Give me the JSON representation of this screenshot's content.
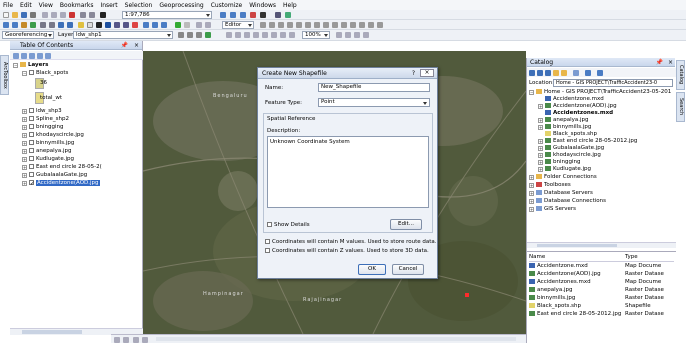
{
  "menu": [
    "File",
    "Edit",
    "View",
    "Bookmarks",
    "Insert",
    "Selection",
    "Geoprocessing",
    "Customize",
    "Windows",
    "Help"
  ],
  "toolbar": {
    "scale": "1:97,786",
    "editor": "Editor",
    "zoom": "100%",
    "georef_label": "Georeferencing",
    "layer_label": "Layer:",
    "layer_value": "ldw_shp1"
  },
  "toc": {
    "title": "Table Of Contents",
    "layers_label": "Layers",
    "items": [
      "Black_spots",
      "36",
      "total_wt",
      "ldw_shp3",
      "Spline_shp2",
      "bningging",
      "khodayscircle.jpg",
      "binnymills.jpg",
      "anepalya.jpg",
      "Kudlugate.jpg",
      "East end circle 28-05-2(",
      "GubalaalaGate.jpg",
      "Accidentzone(AOD.jpg"
    ]
  },
  "dialog": {
    "title": "Create New Shapefile",
    "help": "?",
    "name_label": "Name:",
    "name_value": "New_Shapefile",
    "type_label": "Feature Type:",
    "type_value": "Point",
    "spatial_ref": "Spatial Reference",
    "desc_label": "Description:",
    "desc_value": "Unknown Coordinate System",
    "show_details": "Show Details",
    "edit": "Edit...",
    "m_values": "Coordinates will contain M values. Used to store route data.",
    "z_values": "Coordinates will contain Z values. Used to store 3D data.",
    "ok": "OK",
    "cancel": "Cancel"
  },
  "catalog": {
    "title": "Catalog",
    "location_label": "Location:",
    "location_value": "Home - GIS PROJECT\\TrafficAccident23-0",
    "items": [
      "Home - GIS PROJECT\\TrafficAccident23-05-201",
      "Accidentzone.mxd",
      "Accidentzone(AOD).jpg",
      "Accidentzones.mxd",
      "anepalya.jpg",
      "binnymills.jpg",
      "Black_spots.shp",
      "East end circle 28-05-2012.jpg",
      "GubalaalaGate.jpg",
      "khodayscircle.jpg",
      "bningging",
      "Kudlugate.jpg",
      "Folder Connections",
      "Toolboxes",
      "Database Servers",
      "Database Connections",
      "GIS Servers"
    ]
  },
  "table": {
    "col_name": "Name",
    "col_type": "Type",
    "rows": [
      {
        "name": "Accidentzone.mxd",
        "type": "Map Docume"
      },
      {
        "name": "Accidentzone(AOD).jpg",
        "type": "Raster Datase"
      },
      {
        "name": "Accidentzones.mxd",
        "type": "Map Docume"
      },
      {
        "name": "anepalya.jpg",
        "type": "Raster Datase"
      },
      {
        "name": "binnymills.jpg",
        "type": "Raster Datase"
      },
      {
        "name": "Black_spots.shp",
        "type": "Shapefile"
      },
      {
        "name": "East end circle 28-05-2012.jpg",
        "type": "Raster Datase"
      }
    ]
  },
  "side_tabs": {
    "left": "ArcToolbox",
    "right1": "Catalog",
    "right2": "Search"
  },
  "map_labels": [
    "Bengaluru",
    "Hampinagar",
    "Rajajinagar"
  ]
}
